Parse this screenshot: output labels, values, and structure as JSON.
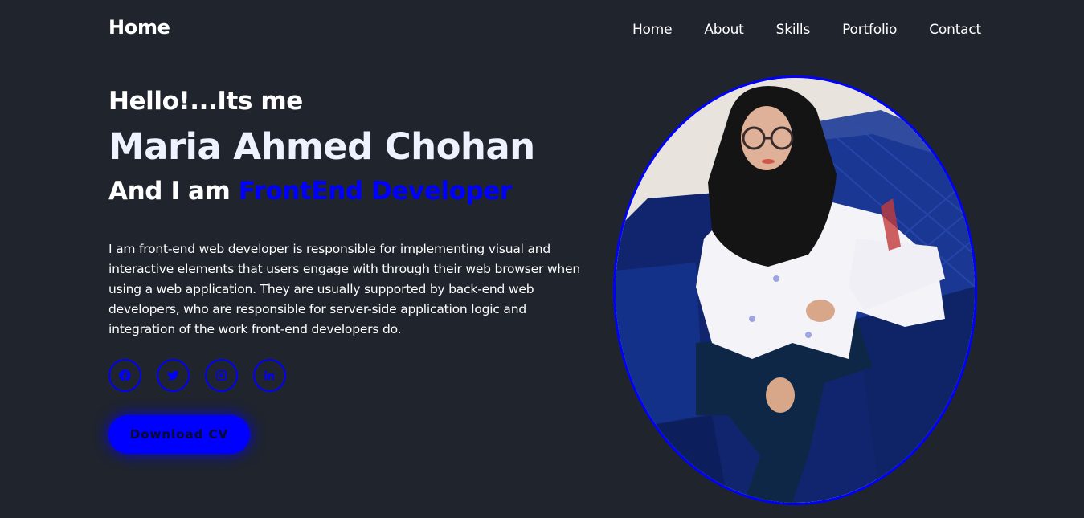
{
  "header": {
    "logo": "Home",
    "nav": [
      "Home",
      "About",
      "Skills",
      "Portfolio",
      "Contact"
    ]
  },
  "hero": {
    "greeting": "Hello!...Its me",
    "name": "Maria Ahmed Chohan",
    "role_prefix": "And I am ",
    "role_highlight": "FrontEnd Developer",
    "bio": "I am front-end web developer is responsible for implementing visual and interactive elements that users engage with through their web browser when using a web application. They are usually supported by back-end web developers, who are responsible for server-side application logic and integration of the work front-end developers do.",
    "socials": [
      "facebook-icon",
      "twitter-icon",
      "instagram-icon",
      "linkedin-icon"
    ],
    "cv_button": "Download CV"
  },
  "colors": {
    "background": "#1f242d",
    "accent": "#0000ff",
    "text": "#ffffff"
  }
}
